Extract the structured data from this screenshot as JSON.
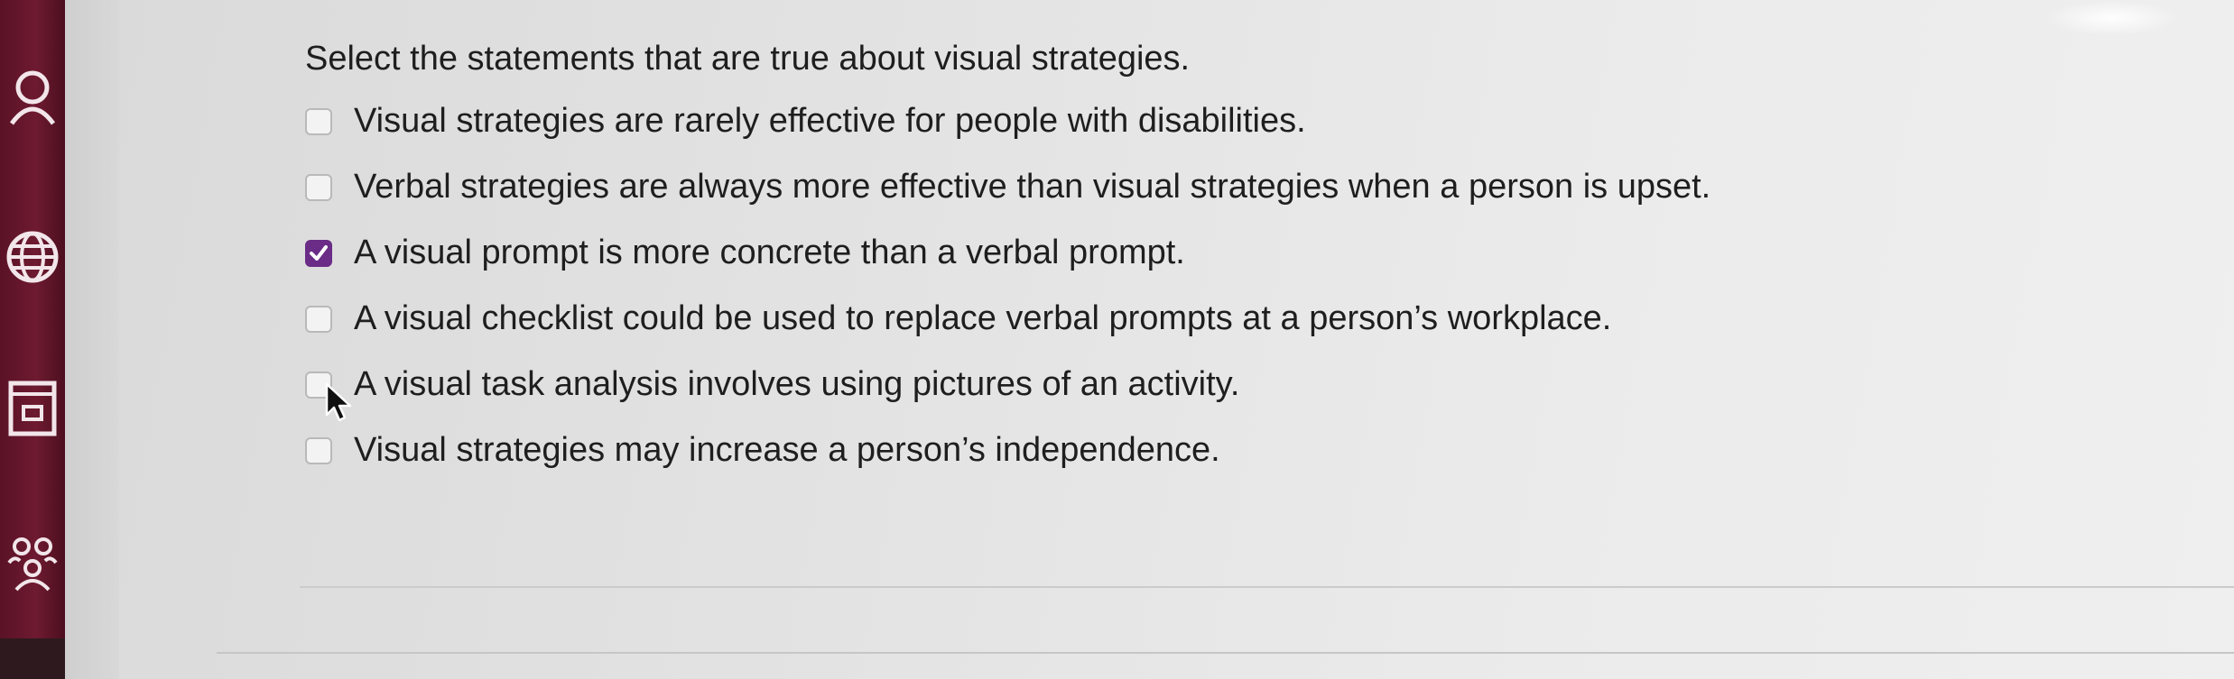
{
  "sidebar": {
    "icons": [
      {
        "name": "user-icon"
      },
      {
        "name": "globe-icon"
      },
      {
        "name": "document-icon"
      },
      {
        "name": "group-icon"
      }
    ],
    "accent": "#6e1a30"
  },
  "question": {
    "prompt": "Select the statements that are true about visual strategies.",
    "options": [
      {
        "label": "Visual strategies are rarely effective for people with disabilities.",
        "checked": false
      },
      {
        "label": "Verbal strategies are always more effective than visual strategies when a person is upset.",
        "checked": false
      },
      {
        "label": "A visual prompt is more concrete than a verbal prompt.",
        "checked": true
      },
      {
        "label": "A visual checklist could be used to replace verbal prompts at a person’s workplace.",
        "checked": false
      },
      {
        "label": "A visual task analysis involves using pictures of an activity.",
        "checked": false
      },
      {
        "label": "Visual strategies may increase a person’s independence.",
        "checked": false
      }
    ],
    "checkbox_checked_color": "#6a2c86"
  }
}
